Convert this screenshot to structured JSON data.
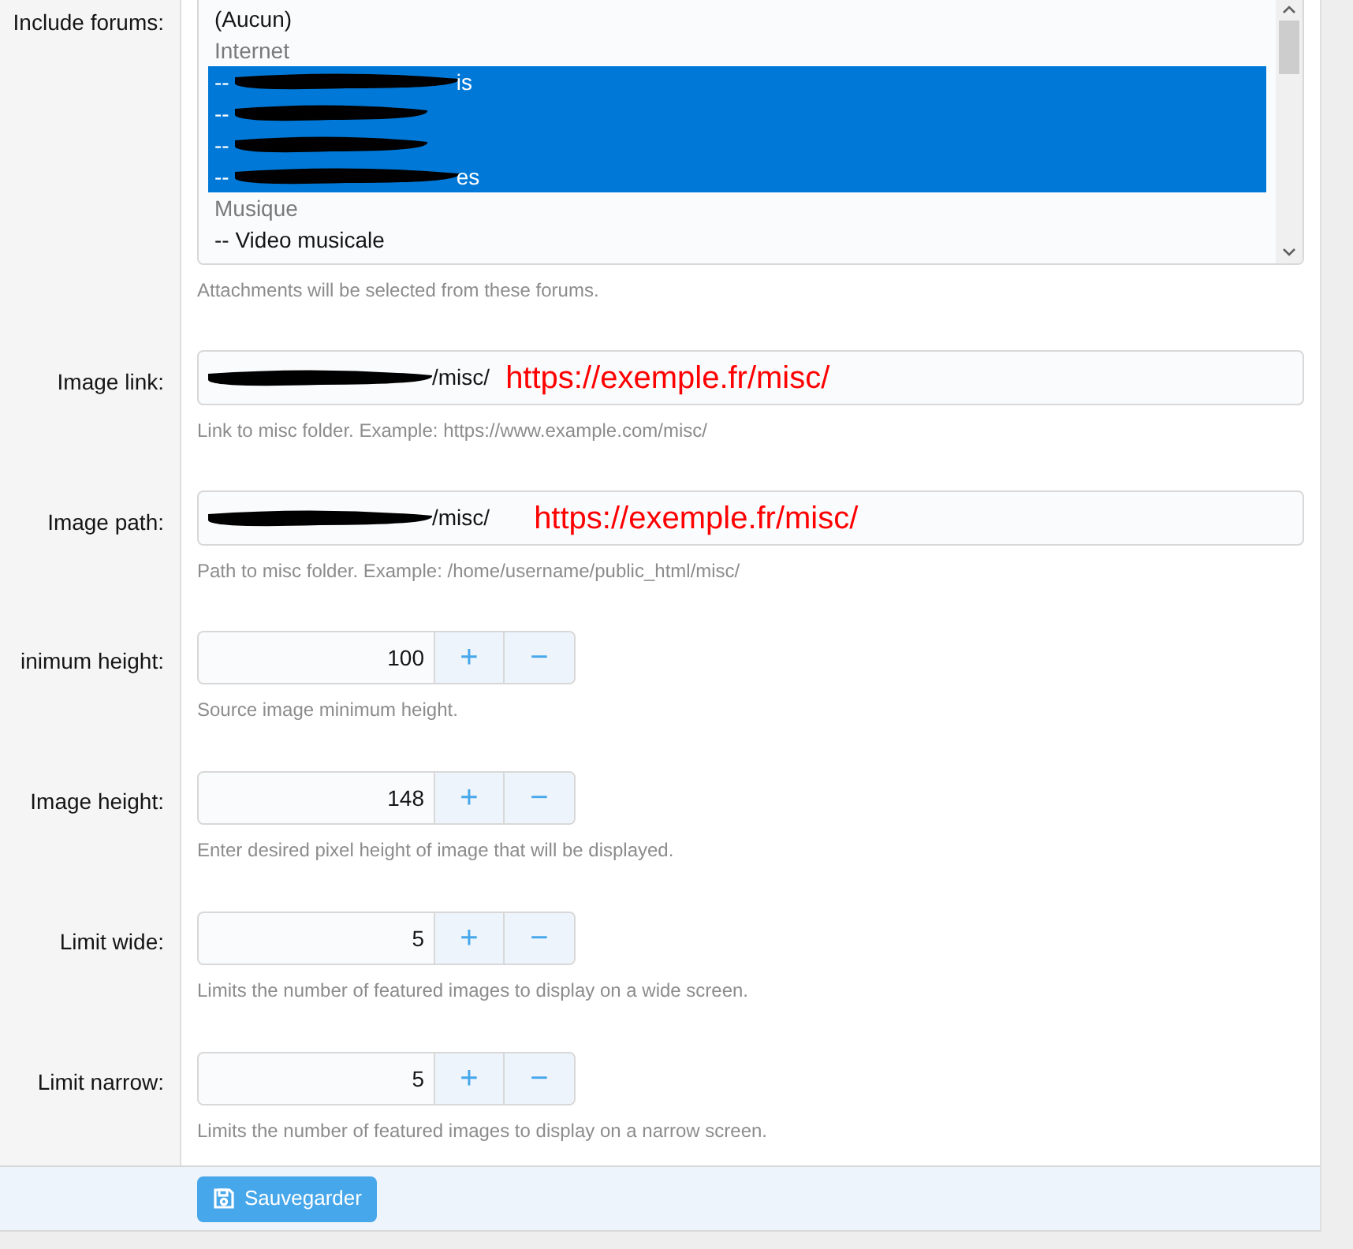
{
  "forums": {
    "label": "Include forums:",
    "options": [
      {
        "kind": "option",
        "text": "(Aucun)",
        "selected": false
      },
      {
        "kind": "group",
        "text": "Internet",
        "selected": false
      },
      {
        "kind": "redacted",
        "prefix": "--",
        "suffix": "is",
        "selected": true
      },
      {
        "kind": "redacted",
        "prefix": "--",
        "selected": true
      },
      {
        "kind": "redacted",
        "prefix": "--",
        "selected": true
      },
      {
        "kind": "redacted",
        "prefix": "--",
        "suffix": "es",
        "selected": true
      },
      {
        "kind": "group",
        "text": "Musique",
        "selected": false
      },
      {
        "kind": "option",
        "text": "-- Video musicale",
        "selected": false
      }
    ],
    "hint": "Attachments will be selected from these forums."
  },
  "text_fields": [
    {
      "label": "Image link:",
      "value": "/misc/",
      "annotation": "https://exemple.fr/misc/",
      "hint": "Link to misc folder. Example: https://www.example.com/misc/"
    },
    {
      "label": "Image path:",
      "value": "/misc/",
      "annotation": "https://exemple.fr/misc/",
      "hint": "Path to misc folder. Example: /home/username/public_html/misc/"
    }
  ],
  "number_fields": [
    {
      "label": "inimum height:",
      "value": "100",
      "plus": "+",
      "minus": "−",
      "hint": "Source image minimum height."
    },
    {
      "label": "Image height:",
      "value": "148",
      "plus": "+",
      "minus": "−",
      "hint": "Enter desired pixel height of image that will be displayed."
    },
    {
      "label": "Limit wide:",
      "value": "5",
      "plus": "+",
      "minus": "−",
      "hint": "Limits the number of featured images to display on a wide screen."
    },
    {
      "label": "Limit narrow:",
      "value": "5",
      "plus": "+",
      "minus": "−",
      "hint": "Limits the number of featured images to display on a narrow screen."
    }
  ],
  "save_button": "Sauvegarder"
}
